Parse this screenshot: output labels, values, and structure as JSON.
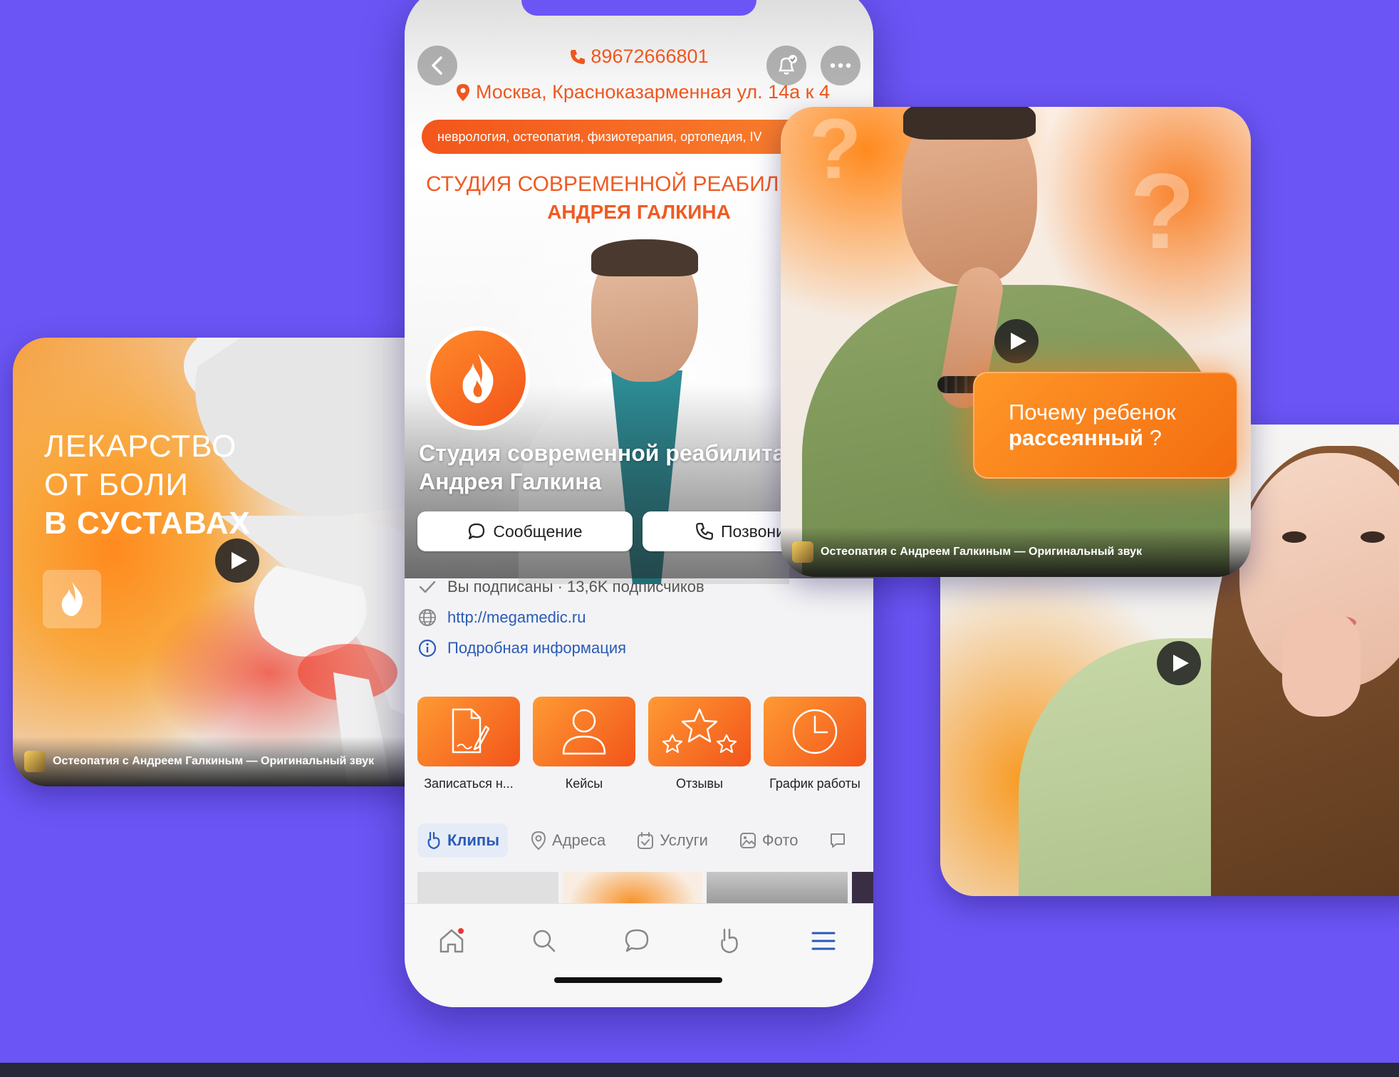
{
  "colors": {
    "background": "#6B55F5",
    "accent_orange": "#F0561E",
    "link_blue": "#2A5BB8",
    "bottom_bar": "#272838"
  },
  "left_clip": {
    "heading_line1": "ЛЕКАРСТВО",
    "heading_line2": "ОТ БОЛИ",
    "heading_line3": "В СУСТАВАХ",
    "footer": "Остеопатия с Андреем Галкиным — Оригинальный звук"
  },
  "top_right_clip": {
    "promo_line1": "Почему ребенок",
    "promo_line2_bold": "рассеянный",
    "promo_line2_rest": " ?",
    "footer": "Остеопатия с Андреем Галкиным — Оригинальный звук"
  },
  "phone": {
    "phone_number": "89672666801",
    "address": "Москва, Краснoказарменная ул. 14а к 4",
    "tags": "неврология, остеопатия, физиотерапия, ортопедия, IV",
    "banner_title": "СТУДИЯ СОВРЕМЕННОЙ РЕАБИЛИ",
    "banner_subtitle": "АНДРЕЯ ГАЛКИНА",
    "group_name_line1": "Студия современной реабилита",
    "group_name_line2": "Андрея Галкина",
    "message_button": "Сообщение",
    "call_button": "Позвони",
    "subscribed": "Вы подписаны · 13,6K подписчиков",
    "website": "http://megamedic.ru",
    "details": "Подробная информация",
    "tiles": [
      {
        "label": "Записаться н...",
        "icon": "document-pen-icon"
      },
      {
        "label": "Кейсы",
        "icon": "person-icon"
      },
      {
        "label": "Отзывы",
        "icon": "stars-icon"
      },
      {
        "label": "График работы",
        "icon": "clock-icon"
      }
    ],
    "tabs": [
      {
        "label": "Клипы",
        "icon": "clips-icon",
        "active": true
      },
      {
        "label": "Адреса",
        "icon": "pin-icon"
      },
      {
        "label": "Услуги",
        "icon": "calendar-check-icon"
      },
      {
        "label": "Фото",
        "icon": "image-icon"
      }
    ],
    "nav": [
      "home-icon",
      "search-icon",
      "chat-icon",
      "clips-icon",
      "menu-icon"
    ]
  }
}
